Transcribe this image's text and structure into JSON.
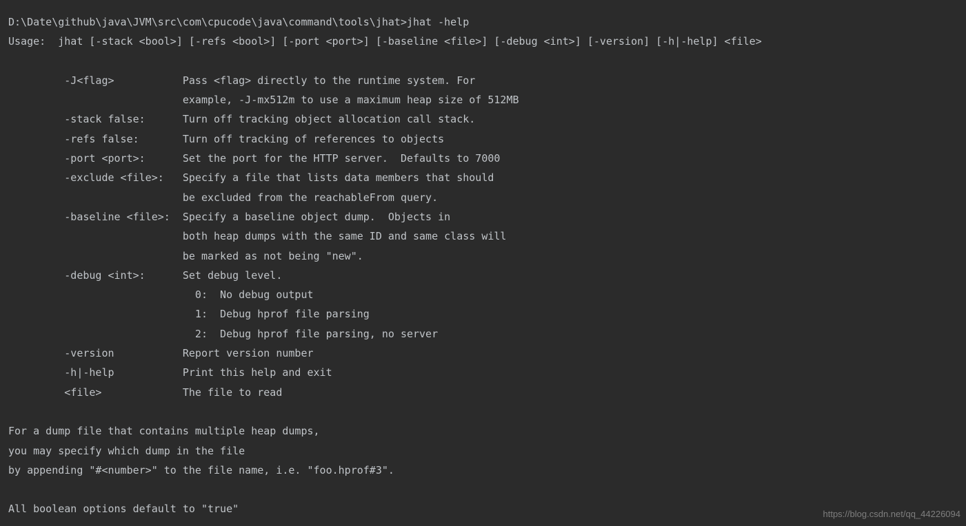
{
  "prompt": "D:\\Date\\github\\java\\JVM\\src\\com\\cpucode\\java\\command\\tools\\jhat>",
  "command": "jhat -help",
  "usage_line": "Usage:  jhat [-stack <bool>] [-refs <bool>] [-port <port>] [-baseline <file>] [-debug <int>] [-version] [-h|-help] <file>",
  "options": [
    {
      "flag": "-J<flag>",
      "desc": [
        "Pass <flag> directly to the runtime system. For",
        "example, -J-mx512m to use a maximum heap size of 512MB"
      ]
    },
    {
      "flag": "-stack false:",
      "desc": [
        "Turn off tracking object allocation call stack."
      ]
    },
    {
      "flag": "-refs false:",
      "desc": [
        "Turn off tracking of references to objects"
      ]
    },
    {
      "flag": "-port <port>:",
      "desc": [
        "Set the port for the HTTP server.  Defaults to 7000"
      ]
    },
    {
      "flag": "-exclude <file>:",
      "desc": [
        "Specify a file that lists data members that should",
        "be excluded from the reachableFrom query."
      ]
    },
    {
      "flag": "-baseline <file>:",
      "desc": [
        "Specify a baseline object dump.  Objects in",
        "both heap dumps with the same ID and same class will",
        "be marked as not being \"new\"."
      ]
    },
    {
      "flag": "-debug <int>:",
      "desc": [
        "Set debug level."
      ],
      "sub": [
        "0:  No debug output",
        "1:  Debug hprof file parsing",
        "2:  Debug hprof file parsing, no server"
      ]
    },
    {
      "flag": "-version",
      "desc": [
        "Report version number"
      ]
    },
    {
      "flag": "-h|-help",
      "desc": [
        "Print this help and exit"
      ]
    },
    {
      "flag": "<file>",
      "desc": [
        "The file to read"
      ]
    }
  ],
  "footer": [
    "For a dump file that contains multiple heap dumps,",
    "you may specify which dump in the file",
    "by appending \"#<number>\" to the file name, i.e. \"foo.hprof#3\".",
    "",
    "All boolean options default to \"true\""
  ],
  "watermark": "https://blog.csdn.net/qq_44226094"
}
